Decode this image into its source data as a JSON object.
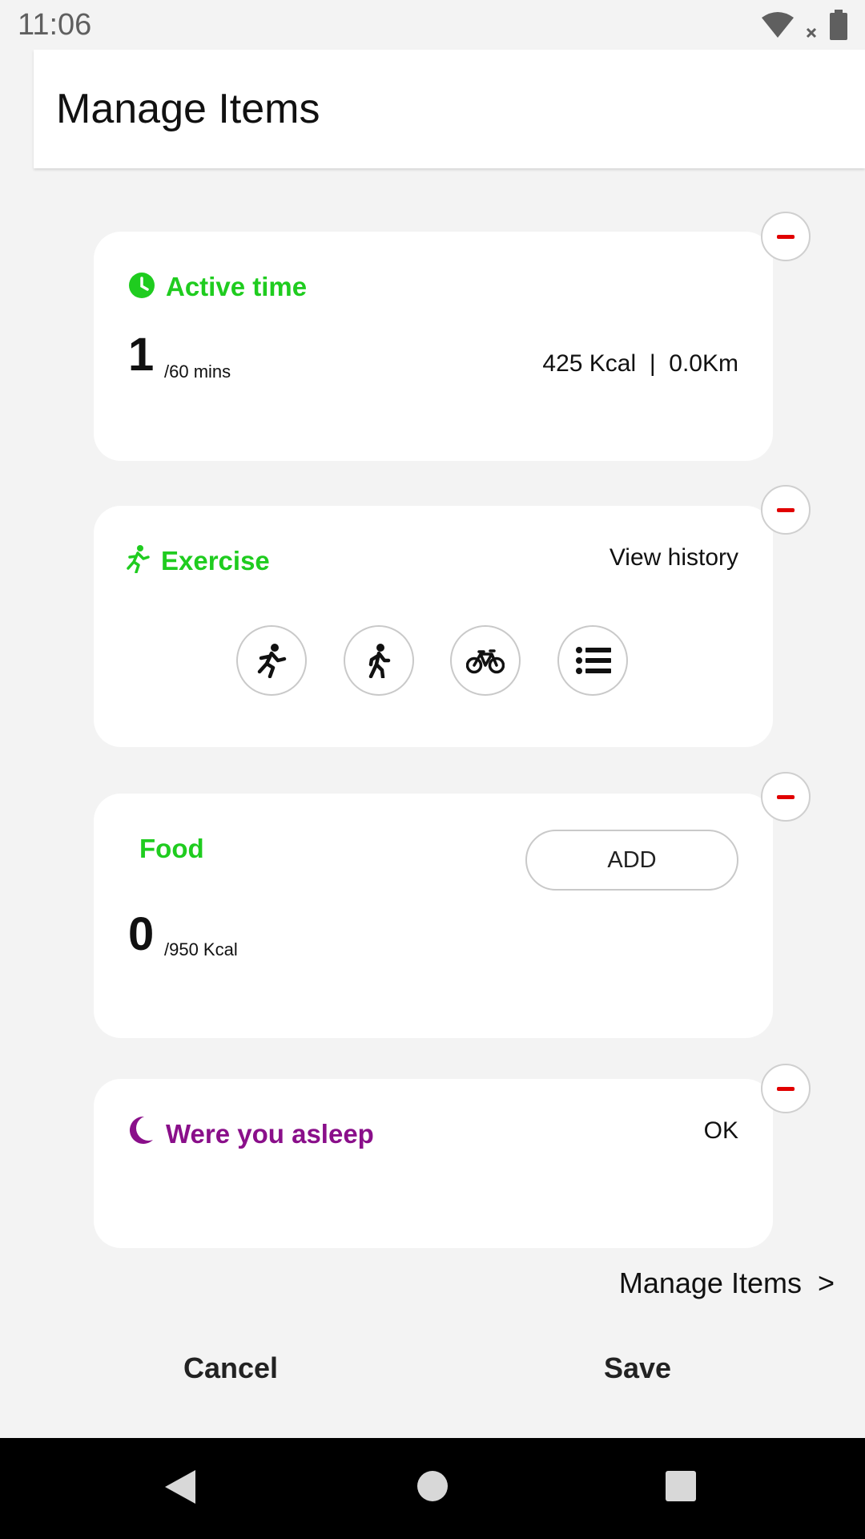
{
  "status_bar": {
    "time": "11:06"
  },
  "app_bar": {
    "title": "Manage Items"
  },
  "active_time": {
    "title": "Active time",
    "value": "1",
    "unit": "/60 mins",
    "stats": "425 Kcal  |  0.0Km"
  },
  "exercise": {
    "title": "Exercise",
    "view_history": "View history",
    "buttons": [
      "running-icon",
      "walking-icon",
      "bicycle-icon",
      "list-icon"
    ]
  },
  "food": {
    "title": "Food",
    "add_label": "ADD",
    "value": "0",
    "unit": "/950 Kcal"
  },
  "sleep": {
    "title": "Were you asleep",
    "ok_label": "OK"
  },
  "manage_link": "Manage Items  >",
  "footer": {
    "cancel": "Cancel",
    "save": "Save"
  },
  "colors": {
    "accent_green": "#1fcc1f",
    "sleep_purple": "#8a0f8a",
    "remove_red": "#e10000"
  }
}
